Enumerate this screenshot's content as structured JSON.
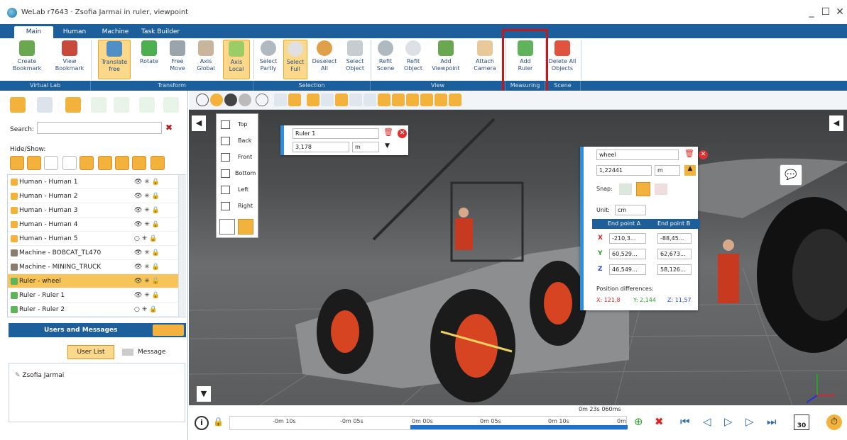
{
  "window": {
    "title": "WeLab r7643 · Zsofia Jarmai in ruler, viewpoint",
    "min": "_",
    "max": "☐",
    "close": "✕"
  },
  "tabs": [
    {
      "label": "Main"
    },
    {
      "label": "Human"
    },
    {
      "label": "Machine"
    },
    {
      "label": "Task Builder"
    }
  ],
  "ribbon": {
    "buttons": [
      {
        "label": "Create\nBookmark"
      },
      {
        "label": "View\nBookmark"
      },
      {
        "label": "Translate\nfree"
      },
      {
        "label": "Rotate"
      },
      {
        "label": "Free\nMove"
      },
      {
        "label": "Axis\nGlobal"
      },
      {
        "label": "Axis\nLocal"
      },
      {
        "label": "Select\nPartly"
      },
      {
        "label": "Select\nFull"
      },
      {
        "label": "Deselect\nAll"
      },
      {
        "label": "Select\nObject"
      },
      {
        "label": "Refit\nScene"
      },
      {
        "label": "Refit\nObject"
      },
      {
        "label": "Add\nViewpoint"
      },
      {
        "label": "Attach\nCamera"
      },
      {
        "label": "Add\nRuler"
      },
      {
        "label": "Delete All\nObjects"
      }
    ],
    "groups": [
      "Virtual Lab",
      "Transform",
      "Selection",
      "View",
      "Measuring",
      "Scene"
    ]
  },
  "left": {
    "search_label": "Search:",
    "search_placeholder": "",
    "hide_show_label": "Hide/Show:",
    "tree": [
      {
        "name": "Human - Human 1"
      },
      {
        "name": "Human - Human 2"
      },
      {
        "name": "Human - Human 3"
      },
      {
        "name": "Human - Human 4"
      },
      {
        "name": "Human - Human 5"
      },
      {
        "name": "Machine - BOBCAT_TL470"
      },
      {
        "name": "Machine - MINING_TRUCK"
      },
      {
        "name": "Ruler - wheel"
      },
      {
        "name": "Ruler - Ruler 1"
      },
      {
        "name": "Ruler - Ruler 2"
      }
    ],
    "users_header": "Users and Messages",
    "user_list_btn": "User List",
    "message_box_btn": "Message Box",
    "users": [
      "Zsofia Jarmai"
    ]
  },
  "view_menu": [
    "Top",
    "Back",
    "Front",
    "Bottom",
    "Left",
    "Right"
  ],
  "ruler1": {
    "name": "Ruler 1",
    "value": "3,178",
    "unit": "m"
  },
  "wheel": {
    "name": "wheel",
    "value": "1,22441",
    "unit": "m",
    "snap_label": "Snap:",
    "unit_label": "Unit:",
    "unit_value": "cm",
    "col_a": "End point A",
    "col_b": "End point B",
    "rows": [
      {
        "axis": "X",
        "a": "-210,3...",
        "b": "-88,45..."
      },
      {
        "axis": "Y",
        "a": "60,529...",
        "b": "62,673..."
      },
      {
        "axis": "Z",
        "a": "46,549...",
        "b": "58,126..."
      }
    ],
    "pos_diff_label": "Position differences:",
    "dx": "X: 121,8",
    "dy": "Y: 2,144",
    "dz": "Z: 11,57"
  },
  "timeline": {
    "time": "0m 23s 060ms",
    "ticks": [
      "-0m 10s",
      "-0m 05s",
      "0m 00s",
      "0m 05s",
      "0m 10s",
      "0m"
    ],
    "speed": "30"
  },
  "colors": {
    "ribbon_blue": "#1d5f9a",
    "highlight_red": "#c0191e",
    "selected_orange": "#f7c45a",
    "panel_accent": "#2f8fdc"
  }
}
